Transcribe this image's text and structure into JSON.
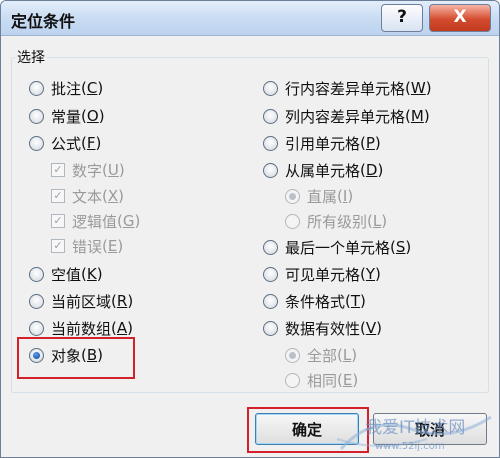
{
  "window": {
    "title": "定位条件",
    "help_glyph": "?",
    "close_glyph": "X"
  },
  "group": {
    "label": "选择"
  },
  "left_options": [
    {
      "label": "批注",
      "key": "C",
      "type": "radio",
      "checked": false,
      "disabled": false
    },
    {
      "label": "常量",
      "key": "O",
      "type": "radio",
      "checked": false,
      "disabled": false
    },
    {
      "label": "公式",
      "key": "F",
      "type": "radio",
      "checked": false,
      "disabled": false
    },
    {
      "label": "数字",
      "key": "U",
      "type": "checkbox",
      "checked": true,
      "disabled": true
    },
    {
      "label": "文本",
      "key": "X",
      "type": "checkbox",
      "checked": true,
      "disabled": true
    },
    {
      "label": "逻辑值",
      "key": "G",
      "type": "checkbox",
      "checked": true,
      "disabled": true
    },
    {
      "label": "错误",
      "key": "E",
      "type": "checkbox",
      "checked": true,
      "disabled": true
    },
    {
      "label": "空值",
      "key": "K",
      "type": "radio",
      "checked": false,
      "disabled": false
    },
    {
      "label": "当前区域",
      "key": "R",
      "type": "radio",
      "checked": false,
      "disabled": false
    },
    {
      "label": "当前数组",
      "key": "A",
      "type": "radio",
      "checked": false,
      "disabled": false
    },
    {
      "label": "对象",
      "key": "B",
      "type": "radio",
      "checked": true,
      "disabled": false
    }
  ],
  "right_options": [
    {
      "label": "行内容差异单元格",
      "key": "W",
      "type": "radio",
      "checked": false,
      "disabled": false
    },
    {
      "label": "列内容差异单元格",
      "key": "M",
      "type": "radio",
      "checked": false,
      "disabled": false
    },
    {
      "label": "引用单元格",
      "key": "P",
      "type": "radio",
      "checked": false,
      "disabled": false
    },
    {
      "label": "从属单元格",
      "key": "D",
      "type": "radio",
      "checked": false,
      "disabled": false
    },
    {
      "label": "直属",
      "key": "I",
      "type": "radio",
      "checked": true,
      "disabled": true
    },
    {
      "label": "所有级别",
      "key": "L",
      "type": "radio",
      "checked": false,
      "disabled": true
    },
    {
      "label": "最后一个单元格",
      "key": "S",
      "type": "radio",
      "checked": false,
      "disabled": false
    },
    {
      "label": "可见单元格",
      "key": "Y",
      "type": "radio",
      "checked": false,
      "disabled": false
    },
    {
      "label": "条件格式",
      "key": "T",
      "type": "radio",
      "checked": false,
      "disabled": false
    },
    {
      "label": "数据有效性",
      "key": "V",
      "type": "radio",
      "checked": false,
      "disabled": false
    },
    {
      "label": "全部",
      "key": "L",
      "type": "radio",
      "checked": true,
      "disabled": true
    },
    {
      "label": "相同",
      "key": "E",
      "type": "radio",
      "checked": false,
      "disabled": true
    }
  ],
  "buttons": {
    "ok": "确定",
    "cancel": "取消"
  },
  "watermark": {
    "text": "我爱IT技术网",
    "url": "www.52ij.com"
  },
  "colors": {
    "highlight": "#d4202a",
    "title_bar": "#c8dbf2",
    "close_button": "#d44c2f"
  }
}
